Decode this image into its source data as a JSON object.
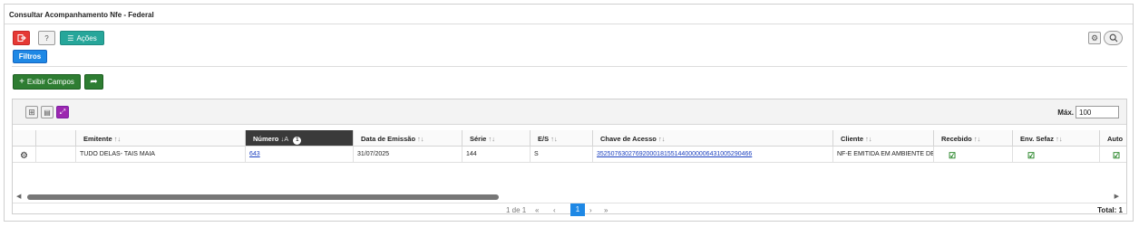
{
  "window": {
    "title": "Consultar Acompanhamento Nfe - Federal"
  },
  "toolbar": {
    "exit_icon": "exit-icon",
    "help_label": "?",
    "actions_label": "Ações",
    "filters_label": "Filtros",
    "show_fields_label": "Exibir Campos",
    "colors": {
      "exit": "#e53935",
      "actions": "#26a69a",
      "filters": "#1e88e5",
      "show_fields": "#2e7d32"
    }
  },
  "grid": {
    "max_label": "Máx.",
    "max_value": "100",
    "columns": [
      {
        "label": "Emitente",
        "sort": "↑↓"
      },
      {
        "label": "Número",
        "sort": "↓A",
        "badge": "1"
      },
      {
        "label": "Data de Emissão",
        "sort": "↑↓"
      },
      {
        "label": "Série",
        "sort": "↑↓"
      },
      {
        "label": "E/S",
        "sort": "↑↓"
      },
      {
        "label": "Chave de Acesso",
        "sort": "↑↓"
      },
      {
        "label": "Cliente",
        "sort": "↑↓"
      },
      {
        "label": "Recebido",
        "sort": "↑↓"
      },
      {
        "label": "Env. Sefaz",
        "sort": "↑↓"
      },
      {
        "label": "Auto",
        "sort": ""
      }
    ],
    "rows": [
      {
        "emitente": "TUDO DELAS- TAIS MAIA",
        "numero": "643",
        "data_emissao": "31/07/2025",
        "serie": "144",
        "es": "S",
        "chave": "35250763027692000181551440000006431005290466",
        "cliente": "NF-E EMITIDA EM AMBIENTE DE H",
        "recebido": true,
        "env_sefaz": true,
        "auto": true
      }
    ]
  },
  "pager": {
    "page_info": "1 de 1",
    "first": "«",
    "prev": "‹",
    "current": "1",
    "next": "›",
    "last": "»",
    "total": "Total: 1"
  }
}
